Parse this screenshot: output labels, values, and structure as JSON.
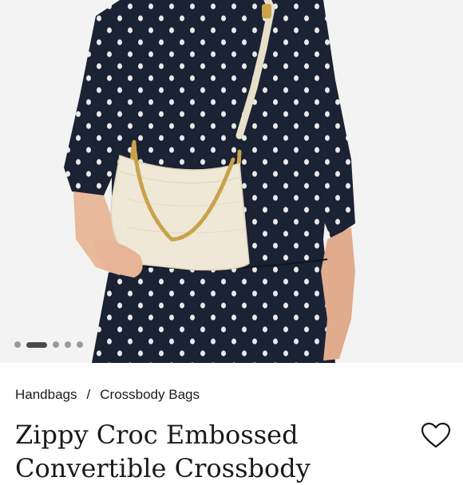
{
  "gallery": {
    "image_alt": "Model wearing a navy dotted dress with a cream croc-embossed crossbody bag on a gold chain",
    "slide_count": 5,
    "active_index": 1
  },
  "breadcrumb": {
    "items": [
      "Handbags",
      "Crossbody Bags"
    ],
    "separator": "/"
  },
  "product": {
    "title": "Zippy Croc Embossed Convertible Crossbody"
  },
  "icons": {
    "favorite": "heart-outline-icon"
  },
  "colors": {
    "dress": "#1b2233",
    "bag": "#efe8d6",
    "chain": "#c9a24a",
    "text": "#1a1a1a"
  }
}
